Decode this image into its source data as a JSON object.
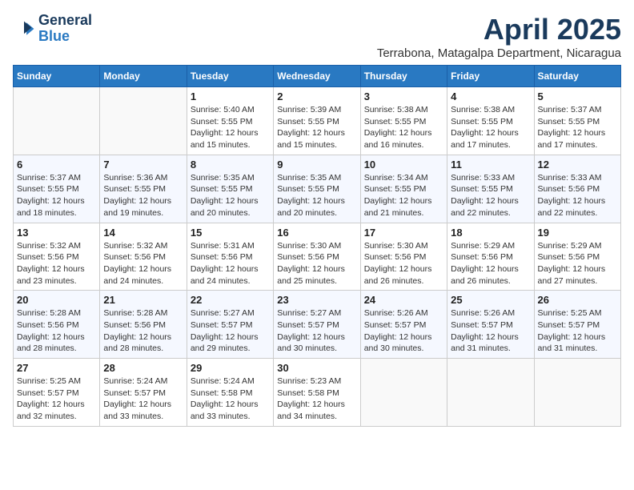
{
  "header": {
    "logo_line1": "General",
    "logo_line2": "Blue",
    "title": "April 2025",
    "subtitle": "Terrabona, Matagalpa Department, Nicaragua"
  },
  "calendar": {
    "days_of_week": [
      "Sunday",
      "Monday",
      "Tuesday",
      "Wednesday",
      "Thursday",
      "Friday",
      "Saturday"
    ],
    "weeks": [
      [
        {
          "day": "",
          "info": ""
        },
        {
          "day": "",
          "info": ""
        },
        {
          "day": "1",
          "sunrise": "5:40 AM",
          "sunset": "5:55 PM",
          "daylight": "12 hours and 15 minutes."
        },
        {
          "day": "2",
          "sunrise": "5:39 AM",
          "sunset": "5:55 PM",
          "daylight": "12 hours and 15 minutes."
        },
        {
          "day": "3",
          "sunrise": "5:38 AM",
          "sunset": "5:55 PM",
          "daylight": "12 hours and 16 minutes."
        },
        {
          "day": "4",
          "sunrise": "5:38 AM",
          "sunset": "5:55 PM",
          "daylight": "12 hours and 17 minutes."
        },
        {
          "day": "5",
          "sunrise": "5:37 AM",
          "sunset": "5:55 PM",
          "daylight": "12 hours and 17 minutes."
        }
      ],
      [
        {
          "day": "6",
          "sunrise": "5:37 AM",
          "sunset": "5:55 PM",
          "daylight": "12 hours and 18 minutes."
        },
        {
          "day": "7",
          "sunrise": "5:36 AM",
          "sunset": "5:55 PM",
          "daylight": "12 hours and 19 minutes."
        },
        {
          "day": "8",
          "sunrise": "5:35 AM",
          "sunset": "5:55 PM",
          "daylight": "12 hours and 20 minutes."
        },
        {
          "day": "9",
          "sunrise": "5:35 AM",
          "sunset": "5:55 PM",
          "daylight": "12 hours and 20 minutes."
        },
        {
          "day": "10",
          "sunrise": "5:34 AM",
          "sunset": "5:55 PM",
          "daylight": "12 hours and 21 minutes."
        },
        {
          "day": "11",
          "sunrise": "5:33 AM",
          "sunset": "5:55 PM",
          "daylight": "12 hours and 22 minutes."
        },
        {
          "day": "12",
          "sunrise": "5:33 AM",
          "sunset": "5:56 PM",
          "daylight": "12 hours and 22 minutes."
        }
      ],
      [
        {
          "day": "13",
          "sunrise": "5:32 AM",
          "sunset": "5:56 PM",
          "daylight": "12 hours and 23 minutes."
        },
        {
          "day": "14",
          "sunrise": "5:32 AM",
          "sunset": "5:56 PM",
          "daylight": "12 hours and 24 minutes."
        },
        {
          "day": "15",
          "sunrise": "5:31 AM",
          "sunset": "5:56 PM",
          "daylight": "12 hours and 24 minutes."
        },
        {
          "day": "16",
          "sunrise": "5:30 AM",
          "sunset": "5:56 PM",
          "daylight": "12 hours and 25 minutes."
        },
        {
          "day": "17",
          "sunrise": "5:30 AM",
          "sunset": "5:56 PM",
          "daylight": "12 hours and 26 minutes."
        },
        {
          "day": "18",
          "sunrise": "5:29 AM",
          "sunset": "5:56 PM",
          "daylight": "12 hours and 26 minutes."
        },
        {
          "day": "19",
          "sunrise": "5:29 AM",
          "sunset": "5:56 PM",
          "daylight": "12 hours and 27 minutes."
        }
      ],
      [
        {
          "day": "20",
          "sunrise": "5:28 AM",
          "sunset": "5:56 PM",
          "daylight": "12 hours and 28 minutes."
        },
        {
          "day": "21",
          "sunrise": "5:28 AM",
          "sunset": "5:56 PM",
          "daylight": "12 hours and 28 minutes."
        },
        {
          "day": "22",
          "sunrise": "5:27 AM",
          "sunset": "5:57 PM",
          "daylight": "12 hours and 29 minutes."
        },
        {
          "day": "23",
          "sunrise": "5:27 AM",
          "sunset": "5:57 PM",
          "daylight": "12 hours and 30 minutes."
        },
        {
          "day": "24",
          "sunrise": "5:26 AM",
          "sunset": "5:57 PM",
          "daylight": "12 hours and 30 minutes."
        },
        {
          "day": "25",
          "sunrise": "5:26 AM",
          "sunset": "5:57 PM",
          "daylight": "12 hours and 31 minutes."
        },
        {
          "day": "26",
          "sunrise": "5:25 AM",
          "sunset": "5:57 PM",
          "daylight": "12 hours and 31 minutes."
        }
      ],
      [
        {
          "day": "27",
          "sunrise": "5:25 AM",
          "sunset": "5:57 PM",
          "daylight": "12 hours and 32 minutes."
        },
        {
          "day": "28",
          "sunrise": "5:24 AM",
          "sunset": "5:57 PM",
          "daylight": "12 hours and 33 minutes."
        },
        {
          "day": "29",
          "sunrise": "5:24 AM",
          "sunset": "5:58 PM",
          "daylight": "12 hours and 33 minutes."
        },
        {
          "day": "30",
          "sunrise": "5:23 AM",
          "sunset": "5:58 PM",
          "daylight": "12 hours and 34 minutes."
        },
        {
          "day": "",
          "info": ""
        },
        {
          "day": "",
          "info": ""
        },
        {
          "day": "",
          "info": ""
        }
      ]
    ],
    "labels": {
      "sunrise": "Sunrise:",
      "sunset": "Sunset:",
      "daylight": "Daylight:"
    }
  }
}
